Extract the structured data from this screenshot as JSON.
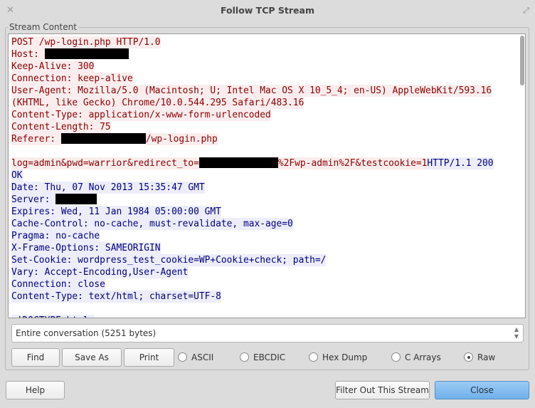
{
  "window": {
    "title": "Follow TCP Stream",
    "close_icon": "✕",
    "maximize_icon": "⤢"
  },
  "frame_label": "Stream Content",
  "colors": {
    "client_text": "#8b0000",
    "client_bg": "#fbeded",
    "server_text": "#000080",
    "server_bg": "#ededfb"
  },
  "stream": [
    [
      {
        "c": "client",
        "t": "POST /wp-login.php HTTP/1.0"
      }
    ],
    [
      {
        "c": "client",
        "t": "Host: "
      },
      {
        "c": "redact"
      }
    ],
    [
      {
        "c": "client",
        "t": "Keep-Alive: 300"
      }
    ],
    [
      {
        "c": "client",
        "t": "Connection: keep-alive"
      }
    ],
    [
      {
        "c": "client",
        "t": "User-Agent: Mozilla/5.0 (Macintosh; U; Intel Mac OS X 10_5_4; en-US) AppleWebKit/593.16"
      }
    ],
    [
      {
        "c": "client",
        "t": "(KHTML, like Gecko) Chrome/10.0.544.295 Safari/483.16"
      }
    ],
    [
      {
        "c": "client",
        "t": "Content-Type: application/x-www-form-urlencoded"
      }
    ],
    [
      {
        "c": "client",
        "t": "Content-Length: 75"
      }
    ],
    [
      {
        "c": "client",
        "t": "Referer: "
      },
      {
        "c": "redact"
      },
      {
        "c": "client",
        "t": "/wp-login.php"
      }
    ],
    [],
    [
      {
        "c": "client",
        "t": "log=admin&pwd=warrior&redirect_to="
      },
      {
        "c": "redact"
      },
      {
        "c": "client",
        "t": "%2Fwp-admin%2F&testcookie=1"
      },
      {
        "c": "server",
        "t": "HTTP/1.1 200"
      }
    ],
    [
      {
        "c": "server",
        "t": "OK"
      }
    ],
    [
      {
        "c": "server",
        "t": "Date: Thu, 07 Nov 2013 15:35:47 GMT"
      }
    ],
    [
      {
        "c": "server",
        "t": "Server: "
      },
      {
        "c": "redact"
      }
    ],
    [
      {
        "c": "server",
        "t": "Expires: Wed, 11 Jan 1984 05:00:00 GMT"
      }
    ],
    [
      {
        "c": "server",
        "t": "Cache-Control: no-cache, must-revalidate, max-age=0"
      }
    ],
    [
      {
        "c": "server",
        "t": "Pragma: no-cache"
      }
    ],
    [
      {
        "c": "server",
        "t": "X-Frame-Options: SAMEORIGIN"
      }
    ],
    [
      {
        "c": "server",
        "t": "Set-Cookie: wordpress_test_cookie=WP+Cookie+check; path=/"
      }
    ],
    [
      {
        "c": "server",
        "t": "Vary: Accept-Encoding,User-Agent"
      }
    ],
    [
      {
        "c": "server",
        "t": "Connection: close"
      }
    ],
    [
      {
        "c": "server",
        "t": "Content-Type: text/html; charset=UTF-8"
      }
    ],
    [],
    [
      {
        "c": "server",
        "t": "<!DOCTYPE html>"
      }
    ]
  ],
  "conversation_select": {
    "value": "Entire conversation (5251 bytes)"
  },
  "buttons": {
    "find": "Find",
    "save_as": "Save As",
    "print": "Print",
    "help": "Help",
    "filter_out": "Filter Out This Stream",
    "close": "Close"
  },
  "formats": [
    {
      "label": "ASCII",
      "selected": false
    },
    {
      "label": "EBCDIC",
      "selected": false
    },
    {
      "label": "Hex Dump",
      "selected": false
    },
    {
      "label": "C Arrays",
      "selected": false
    },
    {
      "label": "Raw",
      "selected": true
    }
  ]
}
